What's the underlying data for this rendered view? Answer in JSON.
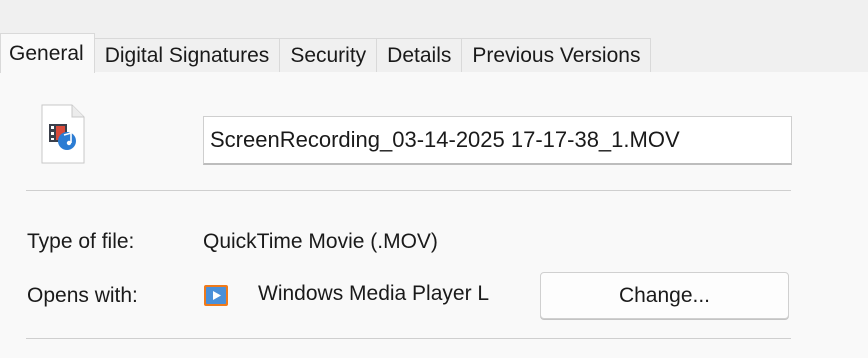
{
  "tabs": [
    {
      "label": "General",
      "active": true
    },
    {
      "label": "Digital Signatures",
      "active": false
    },
    {
      "label": "Security",
      "active": false
    },
    {
      "label": "Details",
      "active": false
    },
    {
      "label": "Previous Versions",
      "active": false
    }
  ],
  "general": {
    "file_icon": "media-file-icon",
    "filename": "ScreenRecording_03-14-2025 17-17-38_1.MOV",
    "type_label": "Type of file:",
    "type_value": "QuickTime Movie (.MOV)",
    "opens_label": "Opens with:",
    "opens_app_icon": "windows-media-player-icon",
    "opens_app_name": "Windows Media Player L",
    "change_label": "Change..."
  },
  "colors": {
    "window_bg": "#f0f0f0",
    "panel_bg": "#f9f9f9",
    "accent_blue": "#2b7cd3",
    "wmp_orange": "#f07a1a"
  }
}
